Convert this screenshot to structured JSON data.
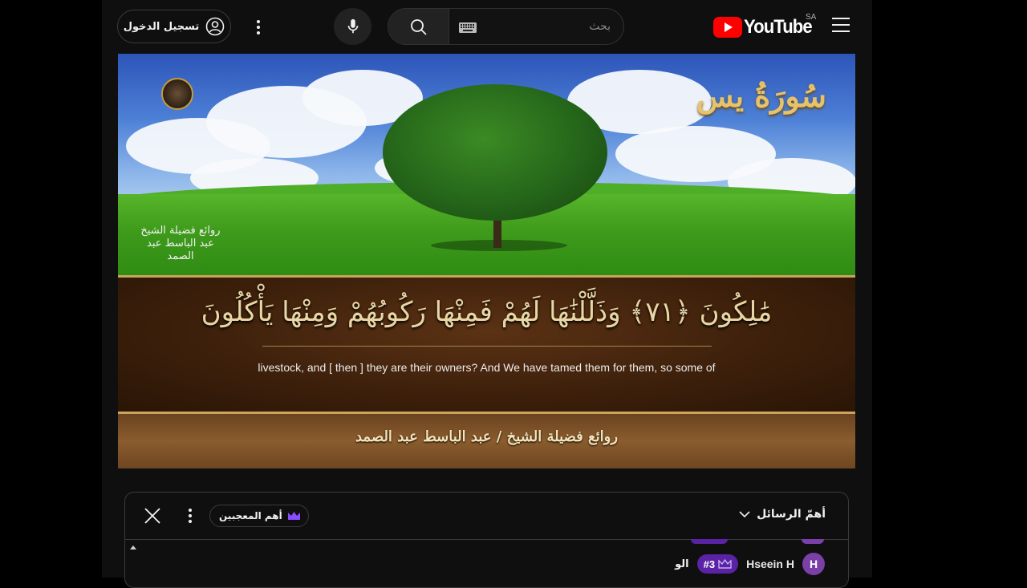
{
  "header": {
    "logo_text": "YouTube",
    "country_code": "SA",
    "search_placeholder": "بحث",
    "sign_in_label": "تسجيل الدخول"
  },
  "video": {
    "surah_title": "سُورَةُ يس",
    "verse_arabic": "مَٰلِكُونَ ﴿٧١﴾ وَذَلَّلْنَٰهَا لَهُمْ فَمِنْهَا رَكُوبُهُمْ وَمِنْهَا يَأْكُلُونَ",
    "translation": "livestock, and [ then ] they are their owners? And We have tamed them for them, so some of",
    "footer_text": "روائع فضيلة الشيخ / عبد الباسط عبد الصمد",
    "calligraphy": "روائع فضيلة الشيخ عبد الباسط عبد الصمد"
  },
  "chat": {
    "top_messages_label": "أهمّ الرسائل",
    "top_fans_label": "أهم المعجبين",
    "messages": [
      {
        "avatar_letter": "H",
        "author": "Hseein H",
        "badge": "#3",
        "text": "الو"
      }
    ]
  },
  "colors": {
    "background": "#0f0f0f",
    "youtube_red": "#ff0000",
    "badge_purple": "#5a22a4",
    "avatar_purple": "#7b3fa8",
    "verse_gold": "#e8d7a5"
  },
  "icons": [
    "hamburger-icon",
    "youtube-logo-icon",
    "keyboard-icon",
    "search-icon",
    "mic-icon",
    "more-vert-icon",
    "account-circle-icon",
    "close-icon",
    "crown-icon",
    "chevron-down-icon"
  ]
}
